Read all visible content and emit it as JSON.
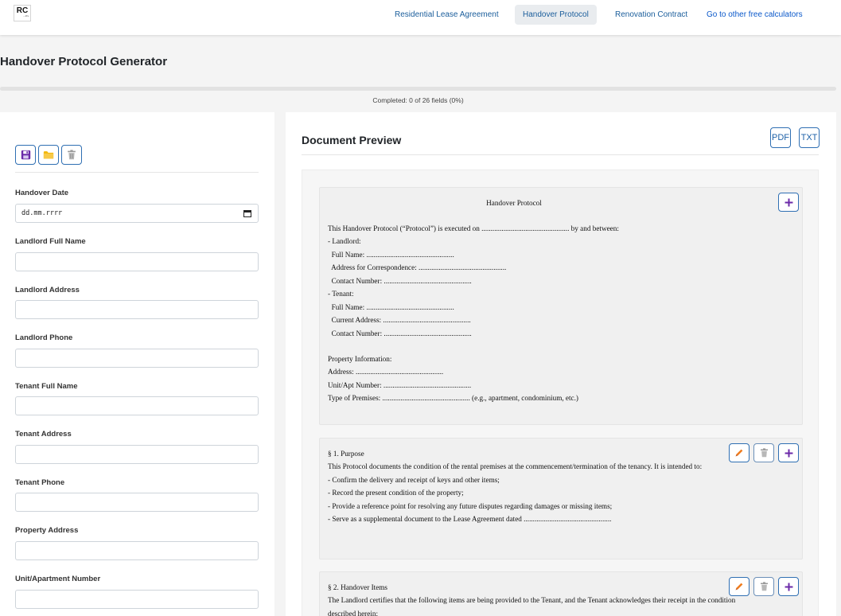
{
  "nav": {
    "logo": "RC",
    "logo_sub": "...it's",
    "links": [
      {
        "label": "Residential Lease Agreement",
        "active": false
      },
      {
        "label": "Handover Protocol",
        "active": true
      },
      {
        "label": "Renovation Contract",
        "active": false
      },
      {
        "label": "Go to other free calculators",
        "active": false
      }
    ]
  },
  "page": {
    "title": "Handover Protocol Generator",
    "progress_text": "Completed: 0 of 26 fields (0%)",
    "progress_percent": 0
  },
  "toolbar": {
    "icons": [
      "save-icon",
      "folder-icon",
      "trash-icon"
    ],
    "colors": {
      "save": "#6b2aa8",
      "folder": "#f2b600",
      "trash": "#9a9a9a"
    }
  },
  "form": {
    "fields": [
      {
        "label": "Handover Date",
        "value": "dd.mm.rrrr",
        "type": "date"
      },
      {
        "label": "Landlord Full Name",
        "value": ""
      },
      {
        "label": "Landlord Address",
        "value": ""
      },
      {
        "label": "Landlord Phone",
        "value": ""
      },
      {
        "label": "Tenant Full Name",
        "value": ""
      },
      {
        "label": "Tenant Address",
        "value": ""
      },
      {
        "label": "Tenant Phone",
        "value": ""
      },
      {
        "label": "Property Address",
        "value": ""
      },
      {
        "label": "Unit/Apartment Number",
        "value": ""
      }
    ]
  },
  "preview": {
    "title": "Document Preview",
    "export": {
      "pdf": "PDF",
      "txt": "TXT"
    },
    "intro": {
      "heading": "Handover Protocol",
      "lines": [
        "This Handover Protocol (“Protocol”) is executed on ................................................ by and between:",
        "- Landlord:",
        "  Full Name: ................................................",
        "  Address for Correspondence: ................................................",
        "  Contact Number: ................................................",
        "- Tenant:",
        "  Full Name: ................................................",
        "  Current Address: ................................................",
        "  Contact Number: ................................................",
        "",
        "Property Information:",
        "Address: ................................................",
        "Unit/Apt Number: ................................................",
        "Type of Premises: ................................................ (e.g., apartment, condominium, etc.)"
      ]
    },
    "section1": {
      "lines": [
        "§ 1. Purpose",
        "This Protocol documents the condition of the rental premises at the commencement/termination of the tenancy. It is intended to:",
        "- Confirm the delivery and receipt of keys and other items;",
        "- Record the present condition of the property;",
        "- Provide a reference point for resolving any future disputes regarding damages or missing items;",
        "- Serve as a supplemental document to the Lease Agreement dated ................................................"
      ]
    },
    "section2": {
      "lines": [
        "§ 2. Handover Items",
        "The Landlord certifies that the following items are being provided to the Tenant, and the Tenant acknowledges their receipt in the condition",
        "described herein:"
      ]
    },
    "action_icons": {
      "edit": "#f07c1e",
      "delete": "#9a9a9a",
      "add": "#6b2aa8"
    }
  }
}
